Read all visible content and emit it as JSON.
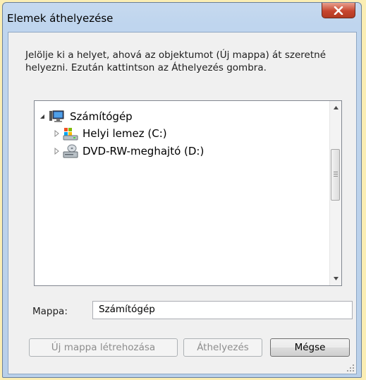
{
  "window": {
    "title": "Elemek áthelyezése",
    "close_icon": "close-x-icon"
  },
  "instructions": "Jelölje ki a helyet, ahová az objektumot (Új mappa) át szeretné helyezni. Ezután kattintson az Áthelyezés gombra.",
  "tree": {
    "items": [
      {
        "label": "Számítógép",
        "icon": "computer-icon",
        "expanded": true,
        "selected": true
      },
      {
        "label": "Helyi lemez (C:)",
        "icon": "local-disk-icon",
        "expanded": false
      },
      {
        "label": "DVD-RW-meghajtó (D:)",
        "icon": "dvd-drive-icon",
        "expanded": false
      }
    ]
  },
  "folder": {
    "label": "Mappa:",
    "value": "Számítógép"
  },
  "buttons": {
    "new_folder": "Új mappa létrehozása",
    "move": "Áthelyezés",
    "cancel": "Mégse"
  }
}
